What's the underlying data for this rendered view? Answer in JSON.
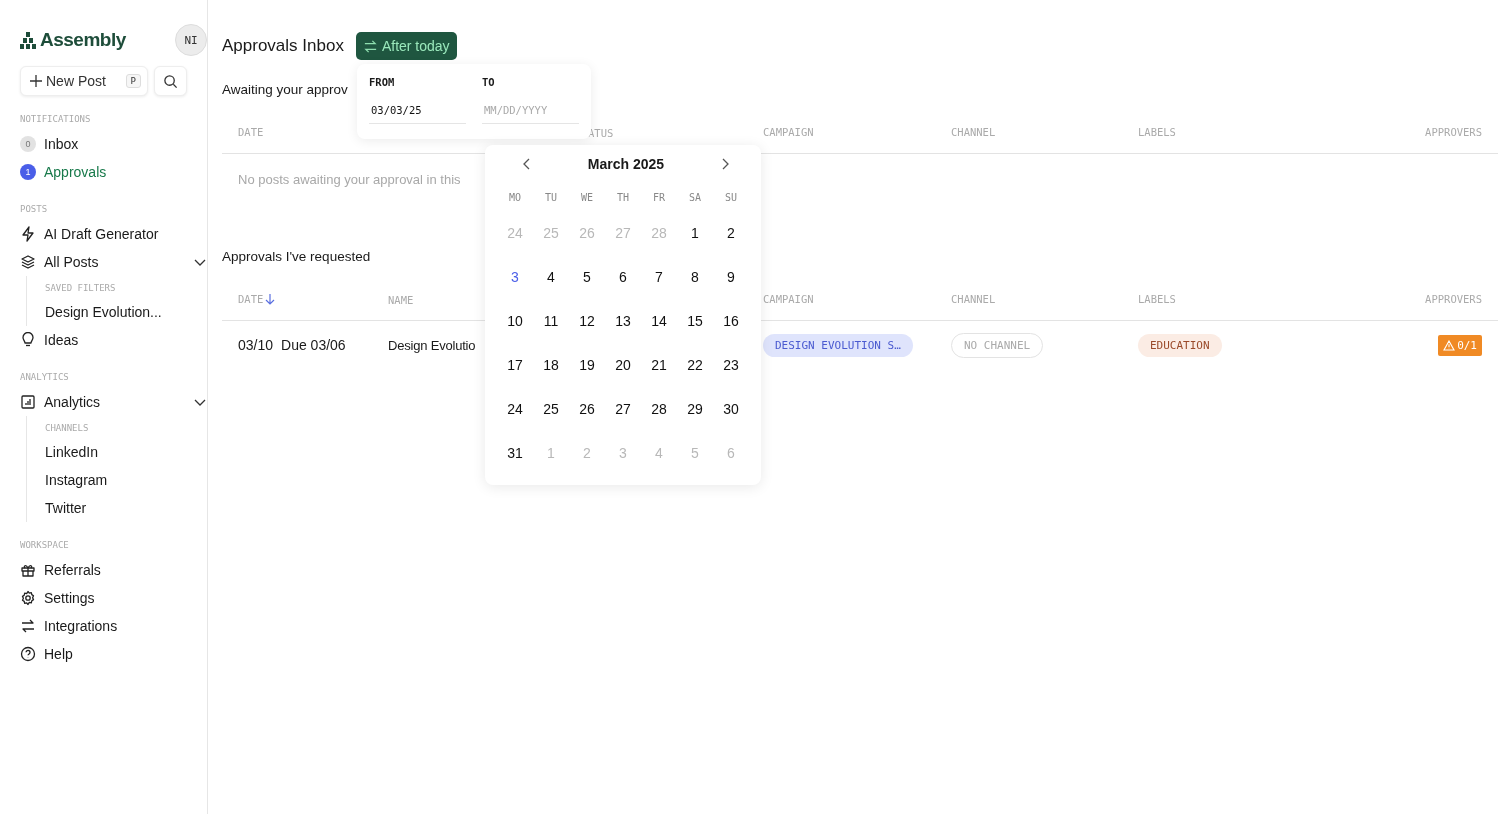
{
  "sidebar": {
    "logo": "Assembly",
    "avatar": "NI",
    "new_post": {
      "label": "New Post",
      "shortcut": "P"
    },
    "sections": [
      {
        "heading": "NOTIFICATIONS",
        "items": [
          {
            "label": "Inbox",
            "badge": "0",
            "selected": false
          },
          {
            "label": "Approvals",
            "badge": "1",
            "selected": true
          }
        ]
      },
      {
        "heading": "POSTS",
        "items": [
          {
            "label": "AI Draft Generator",
            "selected": false
          },
          {
            "label": "All Posts",
            "selected": false,
            "expanded": true,
            "sub_heading": "SAVED FILTERS",
            "children": [
              {
                "label": "Design Evolution..."
              }
            ]
          },
          {
            "label": "Ideas",
            "selected": false
          }
        ]
      },
      {
        "heading": "ANALYTICS",
        "items": [
          {
            "label": "Analytics",
            "selected": false,
            "expanded": true,
            "sub_heading": "CHANNELS",
            "children": [
              {
                "label": "LinkedIn"
              },
              {
                "label": "Instagram"
              },
              {
                "label": "Twitter"
              }
            ]
          }
        ]
      },
      {
        "heading": "WORKSPACE",
        "items": [
          {
            "label": "Referrals",
            "selected": false
          },
          {
            "label": "Settings",
            "selected": false
          },
          {
            "label": "Integrations",
            "selected": false
          },
          {
            "label": "Help",
            "selected": false
          }
        ]
      }
    ]
  },
  "header": {
    "title": "Approvals Inbox",
    "filter": "After today"
  },
  "tables": [
    {
      "heading": "Awaiting your approv",
      "date_sorted": false,
      "columns": {
        "date": "DATE",
        "status": "ATUS",
        "campaign": "CAMPAIGN",
        "channel": "CHANNEL",
        "labels": "LABELS",
        "approvers": "APPROVERS"
      },
      "empty": "No posts awaiting your approval in this"
    },
    {
      "heading": "Approvals I've requested",
      "date_sorted": true,
      "columns": {
        "date": "DATE",
        "name": "NAME",
        "campaign": "CAMPAIGN",
        "channel": "CHANNEL",
        "labels": "LABELS",
        "approvers": "APPROVERS"
      },
      "rows": [
        {
          "date": "03/10",
          "due": "Due 03/06",
          "name": "Design Evolutio",
          "campaign": "DESIGN EVOLUTION S…",
          "channel": "NO CHANNEL",
          "label": "EDUCATION",
          "approvers": "0/1"
        }
      ]
    }
  ],
  "date_range": {
    "from_label": "FROM",
    "from_value": "03/03/25",
    "to_label": "TO",
    "to_placeholder": "MM/DD/YYYY"
  },
  "calendar": {
    "month": "March 2025",
    "weekdays": [
      "MO",
      "TU",
      "WE",
      "TH",
      "FR",
      "SA",
      "SU"
    ],
    "weeks": [
      [
        {
          "day": "24",
          "muted": true,
          "selected": false
        },
        {
          "day": "25",
          "muted": true,
          "selected": false
        },
        {
          "day": "26",
          "muted": true,
          "selected": false
        },
        {
          "day": "27",
          "muted": true,
          "selected": false
        },
        {
          "day": "28",
          "muted": true,
          "selected": false
        },
        {
          "day": "1",
          "muted": false,
          "selected": false
        },
        {
          "day": "2",
          "muted": false,
          "selected": false
        }
      ],
      [
        {
          "day": "3",
          "muted": false,
          "selected": true
        },
        {
          "day": "4",
          "muted": false,
          "selected": false
        },
        {
          "day": "5",
          "muted": false,
          "selected": false
        },
        {
          "day": "6",
          "muted": false,
          "selected": false
        },
        {
          "day": "7",
          "muted": false,
          "selected": false
        },
        {
          "day": "8",
          "muted": false,
          "selected": false
        },
        {
          "day": "9",
          "muted": false,
          "selected": false
        }
      ],
      [
        {
          "day": "10",
          "muted": false,
          "selected": false
        },
        {
          "day": "11",
          "muted": false,
          "selected": false
        },
        {
          "day": "12",
          "muted": false,
          "selected": false
        },
        {
          "day": "13",
          "muted": false,
          "selected": false
        },
        {
          "day": "14",
          "muted": false,
          "selected": false
        },
        {
          "day": "15",
          "muted": false,
          "selected": false
        },
        {
          "day": "16",
          "muted": false,
          "selected": false
        }
      ],
      [
        {
          "day": "17",
          "muted": false,
          "selected": false
        },
        {
          "day": "18",
          "muted": false,
          "selected": false
        },
        {
          "day": "19",
          "muted": false,
          "selected": false
        },
        {
          "day": "20",
          "muted": false,
          "selected": false
        },
        {
          "day": "21",
          "muted": false,
          "selected": false
        },
        {
          "day": "22",
          "muted": false,
          "selected": false
        },
        {
          "day": "23",
          "muted": false,
          "selected": false
        }
      ],
      [
        {
          "day": "24",
          "muted": false,
          "selected": false
        },
        {
          "day": "25",
          "muted": false,
          "selected": false
        },
        {
          "day": "26",
          "muted": false,
          "selected": false
        },
        {
          "day": "27",
          "muted": false,
          "selected": false
        },
        {
          "day": "28",
          "muted": false,
          "selected": false
        },
        {
          "day": "29",
          "muted": false,
          "selected": false
        },
        {
          "day": "30",
          "muted": false,
          "selected": false
        }
      ],
      [
        {
          "day": "31",
          "muted": false,
          "selected": false
        },
        {
          "day": "1",
          "muted": true,
          "selected": false
        },
        {
          "day": "2",
          "muted": true,
          "selected": false
        },
        {
          "day": "3",
          "muted": true,
          "selected": false
        },
        {
          "day": "4",
          "muted": true,
          "selected": false
        },
        {
          "day": "5",
          "muted": true,
          "selected": false
        },
        {
          "day": "6",
          "muted": true,
          "selected": false
        }
      ]
    ]
  }
}
